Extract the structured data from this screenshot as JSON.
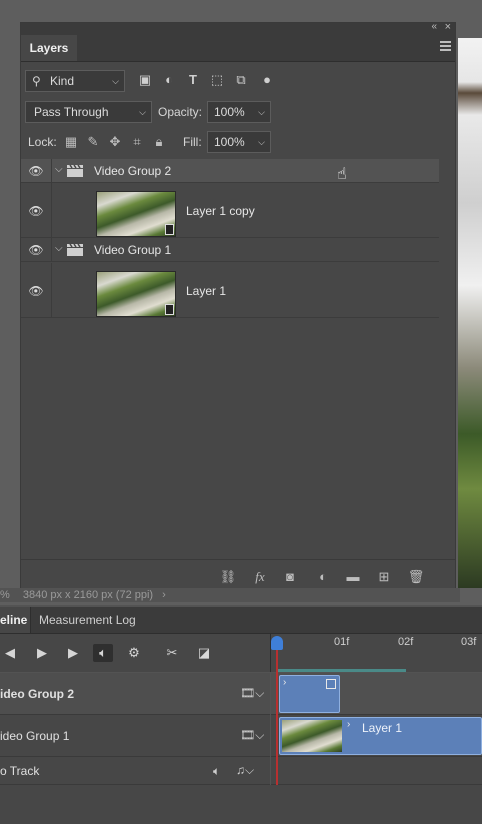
{
  "panel": {
    "tab_label": "Layers",
    "collapse_icon": "«",
    "close_icon": "×",
    "filter": {
      "kind_label": "Kind",
      "icons": [
        "image-filter-icon",
        "adjustment-filter-icon",
        "type-filter-icon",
        "shape-filter-icon",
        "smart-object-filter-icon",
        "filter-toggle-icon"
      ]
    },
    "blend_mode": "Pass Through",
    "opacity_label": "Opacity:",
    "opacity_value": "100%",
    "lock_label": "Lock:",
    "fill_label": "Fill:",
    "fill_value": "100%",
    "layers": [
      {
        "type": "group",
        "name": "Video Group 2"
      },
      {
        "type": "layer",
        "name": "Layer 1 copy"
      },
      {
        "type": "group",
        "name": "Video Group 1"
      },
      {
        "type": "layer",
        "name": "Layer 1"
      }
    ],
    "footer_icons": [
      "link-icon",
      "fx-icon",
      "mask-icon",
      "adjustment-icon",
      "folder-icon",
      "new-layer-icon",
      "trash-icon"
    ]
  },
  "status": {
    "zoom": "%",
    "dimensions": "3840 px x 2160 px (72 ppi)"
  },
  "timeline": {
    "tabs": [
      "eline",
      "Measurement Log"
    ],
    "ruler_labels": [
      "01f",
      "02f",
      "03f"
    ],
    "tracks": [
      {
        "name": "ideo Group 2",
        "bold": true
      },
      {
        "name": "ideo Group 1",
        "bold": false
      },
      {
        "name": "o Track",
        "bold": false
      }
    ],
    "clip_label": "Layer 1"
  },
  "colors": {
    "accent": "#3f7fd8",
    "clip": "#5c80b8",
    "playhead": "#b83030"
  }
}
